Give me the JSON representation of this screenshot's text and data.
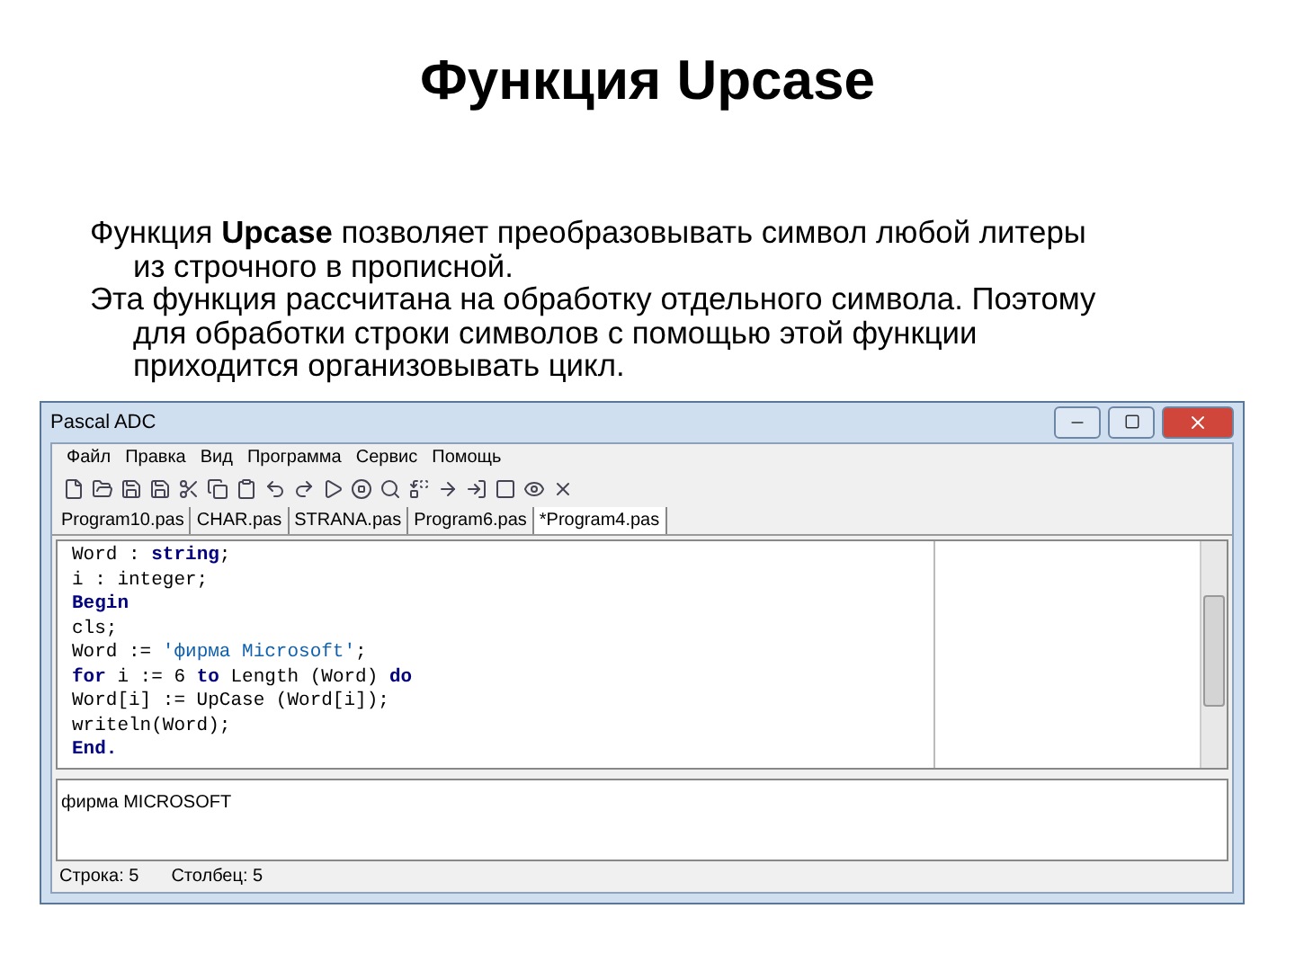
{
  "slide": {
    "title": "Функция Upcase",
    "paragraphs": [
      "Функция **Upcase** позволяет преобразовывать символ любой литеры из строчного в прописной.",
      "Эта функция рассчитана на обработку отдельного символа. Поэтому для обработки строки символов с помощью этой функции приходится организовывать цикл."
    ]
  },
  "window": {
    "title": "Pascal ADC",
    "menu": [
      "Файл",
      "Правка",
      "Вид",
      "Программа",
      "Сервис",
      "Помощь"
    ],
    "tabs": [
      {
        "label": "Program10.pas",
        "selected": false
      },
      {
        "label": "CHAR.pas",
        "selected": false
      },
      {
        "label": "STRANA.pas",
        "selected": false
      },
      {
        "label": "Program6.pas",
        "selected": false
      },
      {
        "label": "*Program4.pas",
        "selected": true
      }
    ],
    "code": [
      [
        {
          "text": "Word : ",
          "kind": "plain"
        },
        {
          "text": "string",
          "kind": "keyword"
        },
        {
          "text": ";",
          "kind": "plain"
        }
      ],
      [
        {
          "text": "i : integer;",
          "kind": "plain"
        }
      ],
      [
        {
          "text": "Begin",
          "kind": "keyword"
        }
      ],
      [
        {
          "text": "cls;",
          "kind": "plain"
        }
      ],
      [
        {
          "text": "Word := ",
          "kind": "plain"
        },
        {
          "text": "'фирма Microsoft'",
          "kind": "string"
        },
        {
          "text": ";",
          "kind": "plain"
        }
      ],
      [
        {
          "text": "for",
          "kind": "keyword"
        },
        {
          "text": " i := 6 ",
          "kind": "plain"
        },
        {
          "text": "to",
          "kind": "keyword"
        },
        {
          "text": " Length (Word) ",
          "kind": "plain"
        },
        {
          "text": "do",
          "kind": "keyword"
        }
      ],
      [
        {
          "text": "Word[i] := UpCase (Word[i]);",
          "kind": "plain"
        }
      ],
      [
        {
          "text": "writeln(Word);",
          "kind": "plain"
        }
      ],
      [
        {
          "text": "End.",
          "kind": "keyword"
        }
      ]
    ],
    "output": "фирма MICROSOFT",
    "status": [
      "Строка: 5",
      "Столбец: 5"
    ]
  }
}
